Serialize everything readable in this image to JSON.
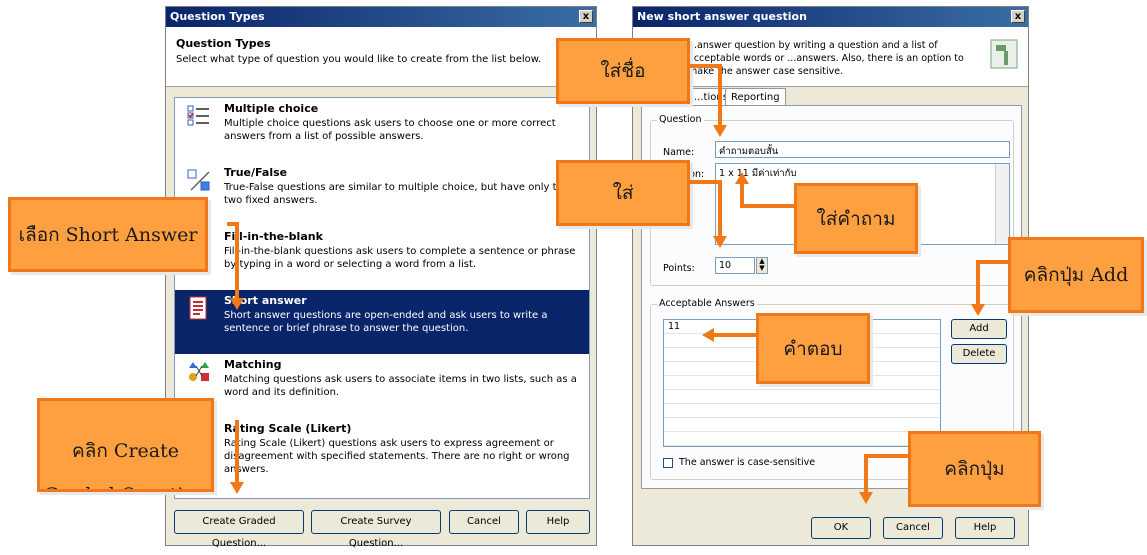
{
  "left_dialog": {
    "title": "Question Types",
    "close_glyph": "x",
    "header_title": "Question Types",
    "header_desc": "Select what type of question you would like to create from the list below.",
    "items": [
      {
        "title": "Multiple choice",
        "desc": "Multiple choice questions ask users to choose one or more correct answers from a list of possible answers.",
        "icon": "multiple-choice-icon"
      },
      {
        "title": "True/False",
        "desc": "True-False questions are similar to multiple choice, but have only the two fixed answers.",
        "icon": "true-false-icon"
      },
      {
        "title": "Fill-in-the-blank",
        "desc": "Fill-in-the-blank questions ask users to complete a sentence or phrase by typing in a word or selecting a word from a list.",
        "icon": "fill-in-blank-icon"
      },
      {
        "title": "Short answer",
        "desc": "Short answer questions are open-ended and ask users to write a sentence or brief phrase to answer the question.",
        "icon": "short-answer-icon",
        "selected": true
      },
      {
        "title": "Matching",
        "desc": "Matching questions ask users to associate items in two lists, such as a word and its definition.",
        "icon": "matching-icon"
      },
      {
        "title": "Rating Scale (Likert)",
        "desc": "Rating Scale (Likert) questions ask users to express agreement or disagreement with specified statements. There are no right or wrong answers.",
        "icon": "likert-icon"
      }
    ],
    "buttons": {
      "create_graded": "Create Graded Question...",
      "create_survey": "Create Survey Question...",
      "cancel": "Cancel",
      "help": "Help"
    }
  },
  "right_dialog": {
    "title": "New short answer question",
    "close_glyph": "x",
    "header_desc": "...answer question by writing a question and a list of acceptable words or ...answers. Also, there is an option to make the answer case sensitive.",
    "tabs": [
      "...tions",
      "Reporting"
    ],
    "question_group": "Question",
    "name_label": "Name:",
    "name_value": "คำถามตอบสั้น",
    "question_label": "...estion:",
    "question_value": "1 x 11 มีค่าเท่ากับ",
    "points_label": "Points:",
    "points_value": "10",
    "answers_group": "Acceptable Answers",
    "answers": [
      "11"
    ],
    "add_button": "Add",
    "delete_button": "Delete",
    "case_sensitive_label": "The answer is case-sensitive",
    "ok_button": "OK",
    "cancel_button": "Cancel",
    "help_button": "Help"
  },
  "callouts": {
    "select_short_answer": "เลือก Short Answer",
    "click_create_graded": "คลิก Create Graded Question",
    "enter_name": "ใส่ชื่อ",
    "enter": "ใส่",
    "enter_question": "ใส่คำถาม",
    "click_add": "คลิกปุ่ม Add",
    "answer": "คำตอบ",
    "click_button": "คลิกปุ่ม"
  },
  "colors": {
    "callout_fill": "#ffa040",
    "callout_border": "#f07818",
    "selection": "#0a246a"
  }
}
